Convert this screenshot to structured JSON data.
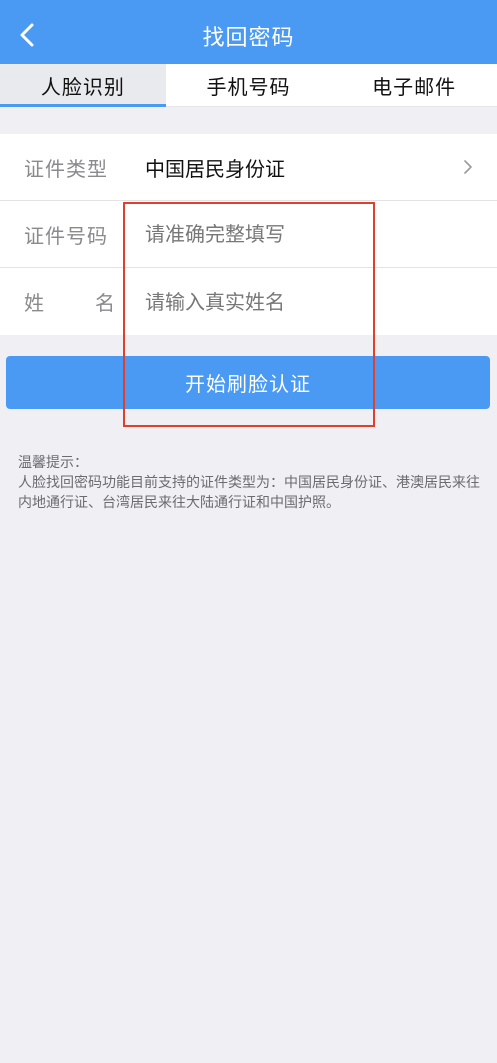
{
  "nav": {
    "title": "找回密码",
    "back_icon": "chevron-left-icon"
  },
  "tabs": [
    {
      "label": "人脸识别",
      "active": true
    },
    {
      "label": "手机号码",
      "active": false
    },
    {
      "label": "电子邮件",
      "active": false
    }
  ],
  "form": {
    "id_type": {
      "label": "证件类型",
      "value": "中国居民身份证"
    },
    "id_number": {
      "label": "证件号码",
      "placeholder": "请准确完整填写"
    },
    "name": {
      "label_chars": [
        "姓",
        "名"
      ],
      "placeholder": "请输入真实姓名"
    }
  },
  "start_button": {
    "label": "开始刷脸认证"
  },
  "tip": {
    "title": "温馨提示：",
    "body": "人脸找回密码功能目前支持的证件类型为：中国居民身份证、港澳居民来往内地通行证、台湾居民来往大陆通行证和中国护照。"
  },
  "colors": {
    "primary": "#4a9af4",
    "highlight": "#e0402b",
    "background": "#efeff4"
  }
}
